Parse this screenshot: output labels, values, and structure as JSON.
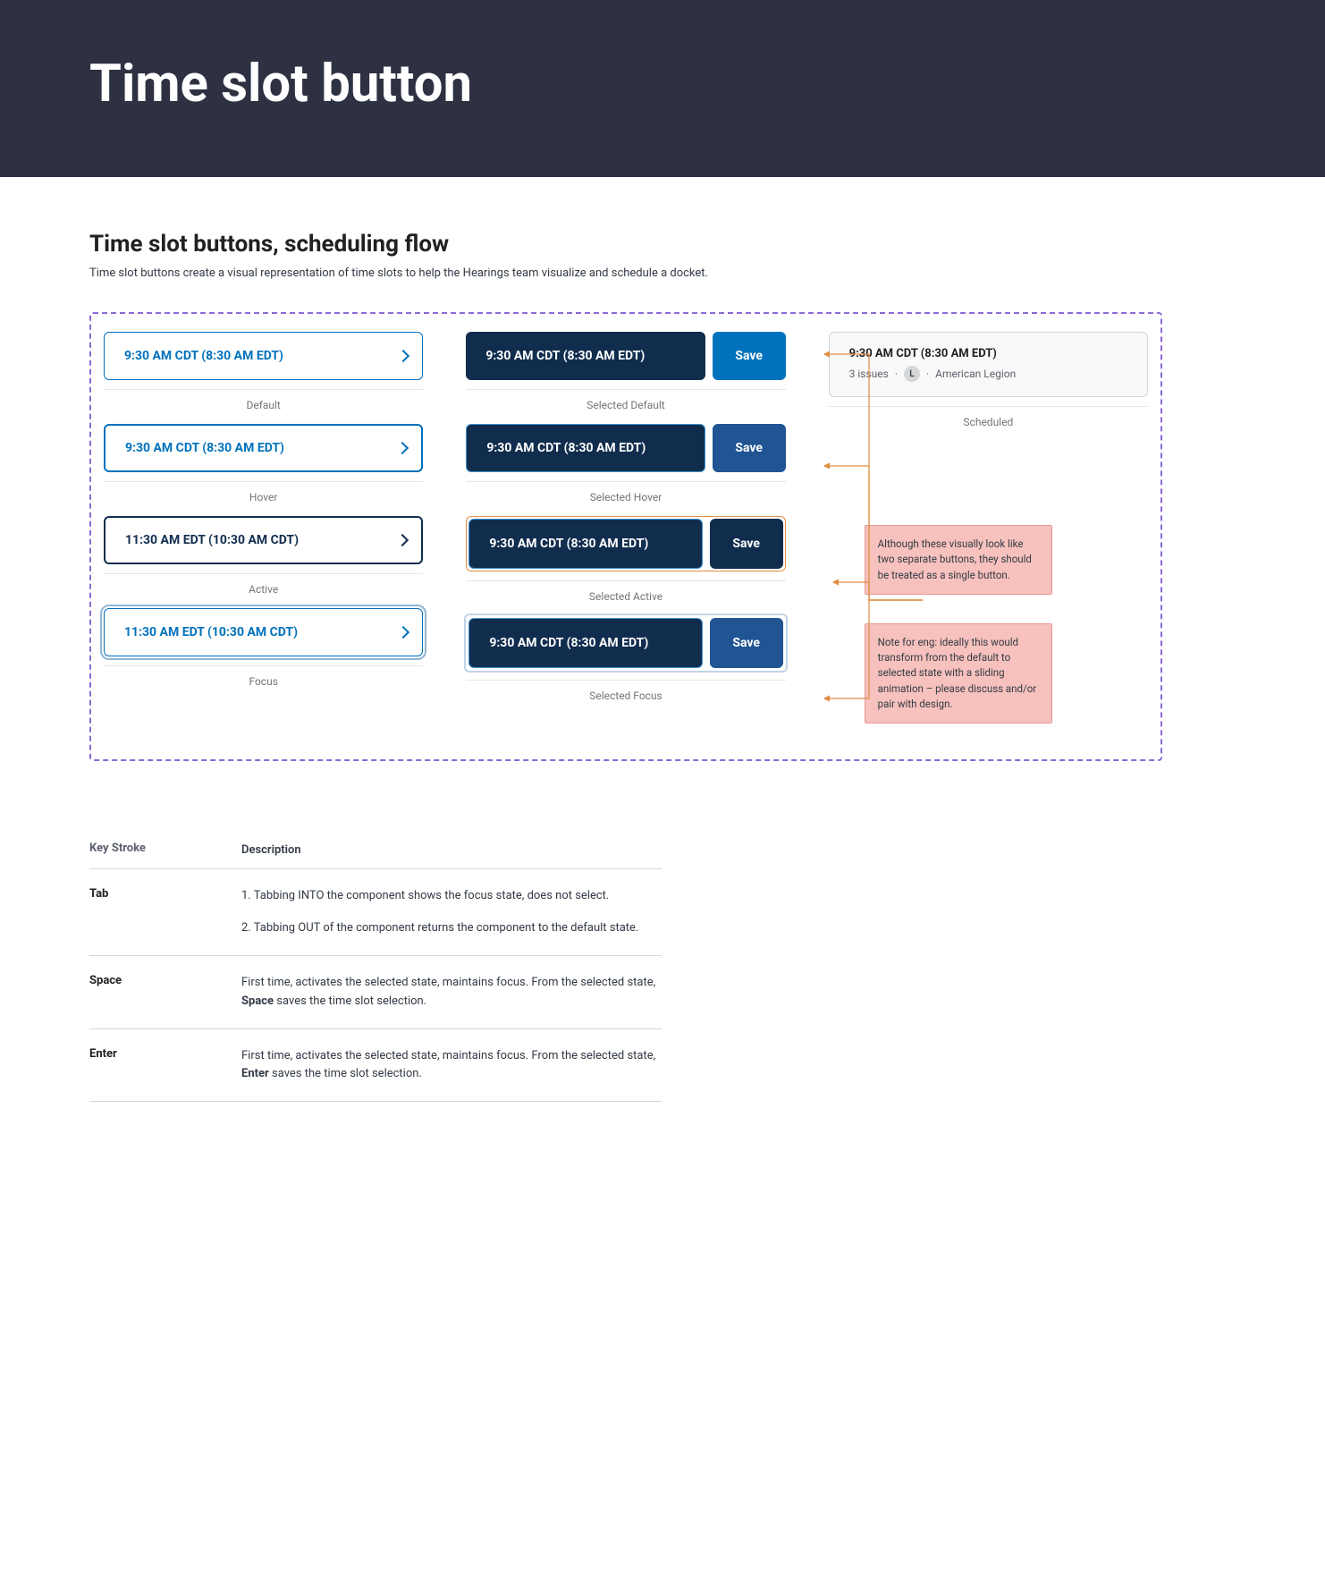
{
  "hero": {
    "title": "Time slot button"
  },
  "section": {
    "title": "Time slot buttons, scheduling flow",
    "desc": "Time slot buttons create a visual representation of time slots to help the Hearings team visualize and schedule a docket."
  },
  "slots": {
    "default": {
      "time": "9:30 AM CDT  (8:30 AM EDT)",
      "label": "Default"
    },
    "hover": {
      "time": "9:30 AM CDT  (8:30 AM EDT)",
      "label": "Hover"
    },
    "active": {
      "time": "11:30 AM EDT  (10:30 AM CDT)",
      "label": "Active"
    },
    "focus": {
      "time": "11:30 AM EDT  (10:30 AM CDT)",
      "label": "Focus"
    }
  },
  "selected": {
    "default": {
      "time": "9:30 AM CDT  (8:30 AM EDT)",
      "save": "Save",
      "label": "Selected Default"
    },
    "hover": {
      "time": "9:30 AM CDT  (8:30 AM EDT)",
      "save": "Save",
      "label": "Selected Hover"
    },
    "active": {
      "time": "9:30 AM CDT  (8:30 AM EDT)",
      "save": "Save",
      "label": "Selected Active"
    },
    "focus": {
      "time": "9:30 AM CDT  (8:30 AM EDT)",
      "save": "Save",
      "label": "Selected Focus"
    }
  },
  "scheduled": {
    "time": "9:30 AM CDT  (8:30 AM EDT)",
    "issues": "3 issues",
    "dot1": "·",
    "badge": "L",
    "dot2": "·",
    "org": "American Legion",
    "label": "Scheduled"
  },
  "notes": {
    "n1": "Although these visually look like two separate buttons, they should be treated as a single button.",
    "n2": "Note for eng: ideally this would transform from the default to selected state with a sliding animation – please discuss and/or pair with design."
  },
  "table": {
    "headers": {
      "c1": "Key Stroke",
      "c2": "Description"
    },
    "rows": [
      {
        "key": "Tab",
        "desc1": "1. Tabbing INTO the component shows the focus state, does not select.",
        "desc2": "2. Tabbing OUT of the component returns the component to the default state."
      },
      {
        "key": "Space",
        "desc_pre": "First time, activates the selected state, maintains focus. From the selected state, ",
        "desc_bold": "Space",
        "desc_post": " saves the time slot selection."
      },
      {
        "key": "Enter",
        "desc_pre": "First time, activates the selected state, maintains focus. From the selected state, ",
        "desc_bold": "Enter",
        "desc_post": " saves the time slot selection."
      }
    ]
  }
}
